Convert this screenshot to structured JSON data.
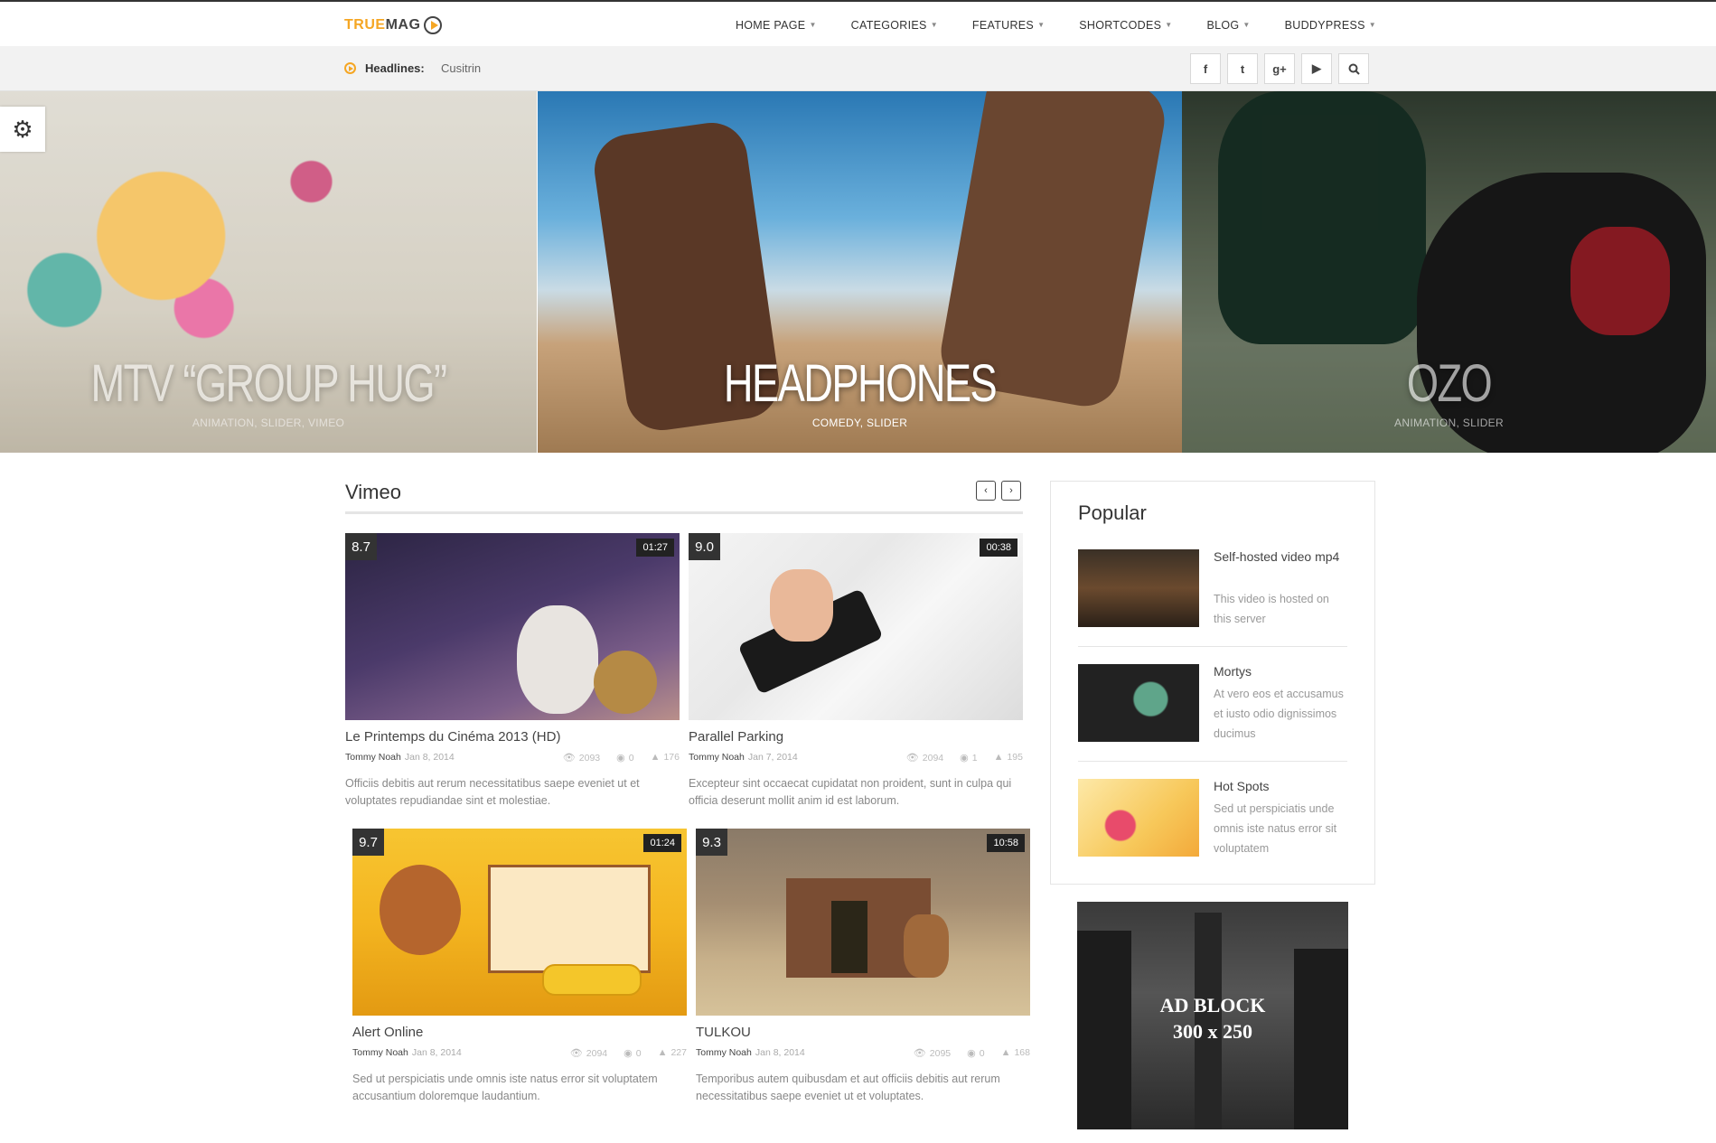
{
  "logo": {
    "part1": "TRUE",
    "part2": "MAG"
  },
  "nav": [
    {
      "label": "HOME PAGE"
    },
    {
      "label": "CATEGORIES"
    },
    {
      "label": "FEATURES"
    },
    {
      "label": "SHORTCODES"
    },
    {
      "label": "BLOG"
    },
    {
      "label": "BUDDYPRESS"
    }
  ],
  "headlines": {
    "label": "Headlines:",
    "text": "Cusitrin"
  },
  "social": [
    "f",
    "t",
    "g+",
    "yt",
    "search"
  ],
  "slides": [
    {
      "title": "MTV “GROUP HUG”",
      "cats": "ANIMATION, SLIDER, VIMEO"
    },
    {
      "title": "HEADPHONES",
      "cats": "COMEDY, SLIDER"
    },
    {
      "title": "OZO",
      "cats": "ANIMATION, SLIDER"
    }
  ],
  "section": {
    "title": "Vimeo"
  },
  "cards": [
    {
      "score": "8.7",
      "duration": "01:27",
      "title": "Le Printemps du Cinéma 2013 (HD)",
      "author": "Tommy Noah",
      "date": "Jan 8, 2014",
      "views": "2093",
      "comments": "0",
      "likes": "176",
      "desc": "Officiis debitis aut rerum necessitatibus saepe eveniet ut et voluptates repudiandae sint et molestiae."
    },
    {
      "score": "9.0",
      "duration": "00:38",
      "title": "Parallel Parking",
      "author": "Tommy Noah",
      "date": "Jan 7, 2014",
      "views": "2094",
      "comments": "1",
      "likes": "195",
      "desc": "Excepteur sint occaecat cupidatat non proident, sunt in culpa qui officia deserunt mollit anim id est laborum."
    },
    {
      "score": "9.7",
      "duration": "01:24",
      "title": "Alert Online",
      "author": "Tommy Noah",
      "date": "Jan 8, 2014",
      "views": "2094",
      "comments": "0",
      "likes": "227",
      "desc": "Sed ut perspiciatis unde omnis iste natus error sit voluptatem accusantium doloremque laudantium."
    },
    {
      "score": "9.3",
      "duration": "10:58",
      "title": "TULKOU",
      "author": "Tommy Noah",
      "date": "Jan 8, 2014",
      "views": "2095",
      "comments": "0",
      "likes": "168",
      "desc": "Temporibus autem quibusdam et aut officiis debitis aut rerum necessitatibus saepe eveniet ut et voluptates."
    }
  ],
  "popular": {
    "title": "Popular",
    "items": [
      {
        "name": "Self-hosted video mp4",
        "desc": "This video is hosted on this server"
      },
      {
        "name": "Mortys",
        "desc": "At vero eos et accusamus et iusto odio dignissimos ducimus"
      },
      {
        "name": "Hot Spots",
        "desc": "Sed ut perspiciatis unde omnis iste natus error sit voluptatem"
      }
    ]
  },
  "ad": {
    "line1": "AD BLOCK",
    "line2": "300 x 250"
  }
}
